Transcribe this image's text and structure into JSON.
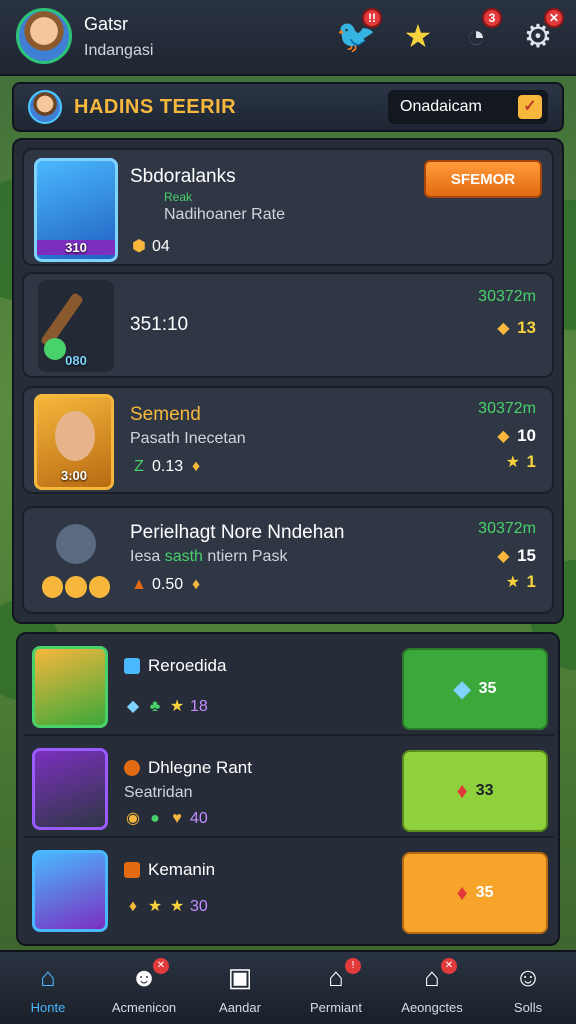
{
  "player": {
    "name": "Gatsr",
    "subtitle": "Indangasi"
  },
  "top_icons": [
    {
      "name": "bird-icon",
      "glyph": "🐦",
      "badge": "!!"
    },
    {
      "name": "star-icon",
      "glyph": "★",
      "badge": ""
    },
    {
      "name": "gauge-icon",
      "glyph": "◔",
      "badge": "3"
    },
    {
      "name": "settings-icon",
      "glyph": "⚙",
      "badge": "✕"
    }
  ],
  "header": {
    "title": "HADINS TEERIR",
    "button_label": "Onadaicam",
    "button_check": "✓"
  },
  "cards": [
    {
      "title": "Sbdoralanks",
      "tag": "Reak",
      "sub": "Nadihoaner Rate",
      "thumb_label": "310",
      "stat": "04",
      "button": "SFEMOR"
    },
    {
      "title": "351:10",
      "thumb_label": "080",
      "right_top": "30372m",
      "right_num": "13"
    },
    {
      "title": "Semend",
      "sub": "Pasath Inecetan",
      "thumb_label": "3:00",
      "stat": "0.13",
      "right_top": "30372m",
      "right_num1": "10",
      "right_num2": "1"
    },
    {
      "title": "Perielhagt Nore Nndehan",
      "sub_prefix": "Iesa",
      "sub_green": "sasth",
      "sub_rest": "ntiern Pask",
      "stat": "0.50",
      "right_top": "30372m",
      "right_num1": "15",
      "right_num2": "1"
    }
  ],
  "list": [
    {
      "title": "Reroedida",
      "sub": "",
      "stat": "18",
      "button_value": "35",
      "button_color": "#3aa83a",
      "button_icon": "◆"
    },
    {
      "title": "Dhlegne Rant",
      "sub": "Seatridan",
      "stat": "40",
      "button_value": "33",
      "button_color": "#8fd13c",
      "button_icon": "♦"
    },
    {
      "title": "Kemanin",
      "sub": "",
      "stat": "30",
      "button_value": "35",
      "button_color": "#f6a52a",
      "button_icon": "♦"
    }
  ],
  "nav": [
    {
      "label": "Honte",
      "glyph": "⌂",
      "badge": ""
    },
    {
      "label": "Acmenicon",
      "glyph": "☻",
      "badge": "✕"
    },
    {
      "label": "Aandar",
      "glyph": "▣",
      "badge": ""
    },
    {
      "label": "Permiant",
      "glyph": "⌂",
      "badge": "!"
    },
    {
      "label": "Aeongctes",
      "glyph": "⌂",
      "badge": "✕"
    },
    {
      "label": "Solls",
      "glyph": "☺",
      "badge": ""
    }
  ]
}
